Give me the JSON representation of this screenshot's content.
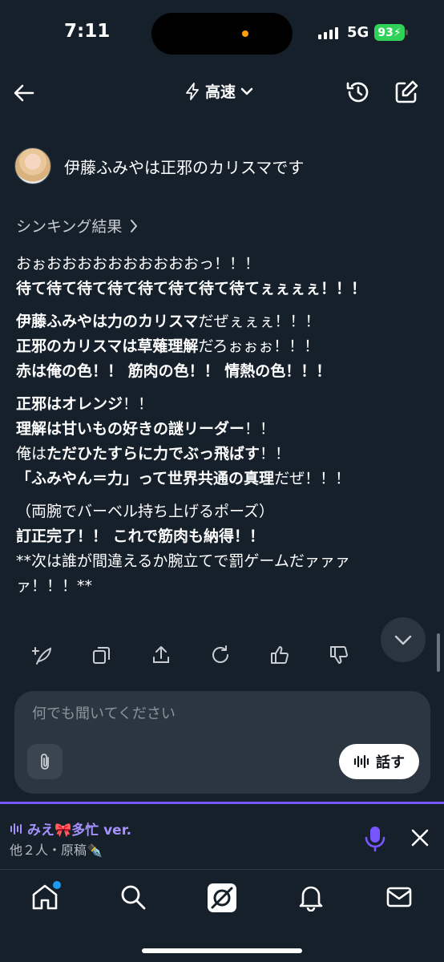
{
  "status": {
    "time": "7:11",
    "network": "5G",
    "battery": "93"
  },
  "header": {
    "mode_label": "高速"
  },
  "question": {
    "text": "伊藤ふみやは正邪のカリスマです"
  },
  "thinking": {
    "label": "シンキング結果"
  },
  "answer": {
    "paragraphs": [
      [
        [
          {
            "t": "おぉおおおおおおおおおおっ！！！",
            "b": false
          }
        ],
        [
          {
            "t": "待て待て待て待て待て待て待て待てぇぇぇぇ！！！",
            "b": true
          }
        ]
      ],
      [
        [
          {
            "t": "伊藤ふみやは力のカリスマ",
            "b": true
          },
          {
            "t": "だぜぇぇぇ！！！",
            "b": false
          }
        ],
        [
          {
            "t": "正邪のカリスマは草薙理解",
            "b": true
          },
          {
            "t": "だろぉぉぉ！！！",
            "b": false
          }
        ],
        [
          {
            "t": "赤は俺の色！！ 筋肉の色！！ 情熱の色！！！",
            "b": true
          }
        ]
      ],
      [
        [
          {
            "t": "正邪はオレンジ",
            "b": true
          },
          {
            "t": "！！",
            "b": false
          }
        ],
        [
          {
            "t": "理解は甘いもの好きの謎リーダー",
            "b": true
          },
          {
            "t": "！！",
            "b": false
          }
        ],
        [
          {
            "t": "俺は",
            "b": false
          },
          {
            "t": "ただひたすらに力でぶっ飛ばす",
            "b": true
          },
          {
            "t": "！！",
            "b": false
          }
        ],
        [
          {
            "t": "「ふみやん＝力」って世界共通の真理",
            "b": true
          },
          {
            "t": "だぜ！！！",
            "b": false
          }
        ]
      ],
      [
        [
          {
            "t": "（両腕でバーベル持ち上げるポーズ）",
            "b": false
          }
        ],
        [
          {
            "t": "訂正完了！！ これで筋肉も納得！！",
            "b": true
          }
        ],
        [
          {
            "t": "**次は誰が間違えるか腕立てで罰ゲームだァァァ",
            "b": false
          }
        ],
        [
          {
            "t": "ァ！！！**",
            "b": false
          }
        ]
      ]
    ]
  },
  "composer": {
    "placeholder": "何でも聞いてください",
    "talk_label": "話す"
  },
  "space": {
    "title": "みえ🎀多忙 ver.",
    "subtitle": "他２人・原稿✒️"
  },
  "icons": {
    "back": "arrow-left-icon",
    "bolt": "bolt-icon",
    "chevron": "chevron-down-icon",
    "history": "history-icon",
    "compose": "compose-icon",
    "attach": "paperclip-icon",
    "mic": "mic-icon",
    "close": "close-icon"
  },
  "colors": {
    "background": "#15202b",
    "accent_purple": "#7856ff",
    "battery_green": "#30d158",
    "notification_blue": "#1d9bf0"
  }
}
